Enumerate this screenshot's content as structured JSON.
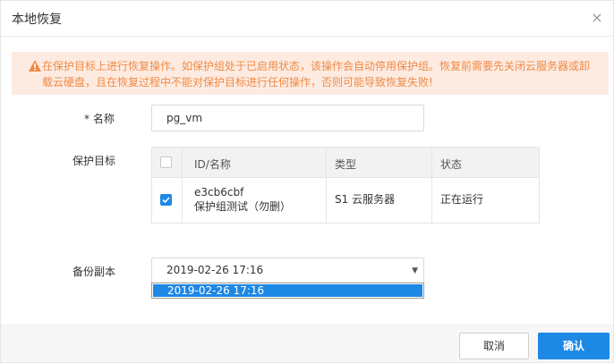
{
  "dialog": {
    "title": "本地恢复",
    "close_glyph": "×"
  },
  "alert": {
    "icon": "warning-icon",
    "text": "在保护目标上进行恢复操作。如保护组处于已启用状态，该操作会自动停用保护组。恢复前需要先关闭云服务器或卸载云硬盘，且在恢复过程中不能对保护目标进行任何操作，否则可能导致恢复失败!"
  },
  "form": {
    "name_label": "* 名称",
    "name_value": "pg_vm",
    "target_label": "保护目标",
    "backup_label": "备份副本"
  },
  "table": {
    "headers": [
      "ID/名称",
      "类型",
      "状态"
    ],
    "rows": [
      {
        "checked": true,
        "id": "e3cb6cbf",
        "name": "保护组测试（勿删）",
        "type": "S1 云服务器",
        "status": "正在运行"
      }
    ]
  },
  "select": {
    "value": "2019-02-26 17:16",
    "options": [
      "2019-02-26 17:16"
    ]
  },
  "footer": {
    "cancel_label": "取消",
    "ok_label": "确认"
  },
  "colors": {
    "accent": "#1e88e5",
    "warning_text": "#f08a45",
    "warning_bg": "#fdebe1"
  }
}
